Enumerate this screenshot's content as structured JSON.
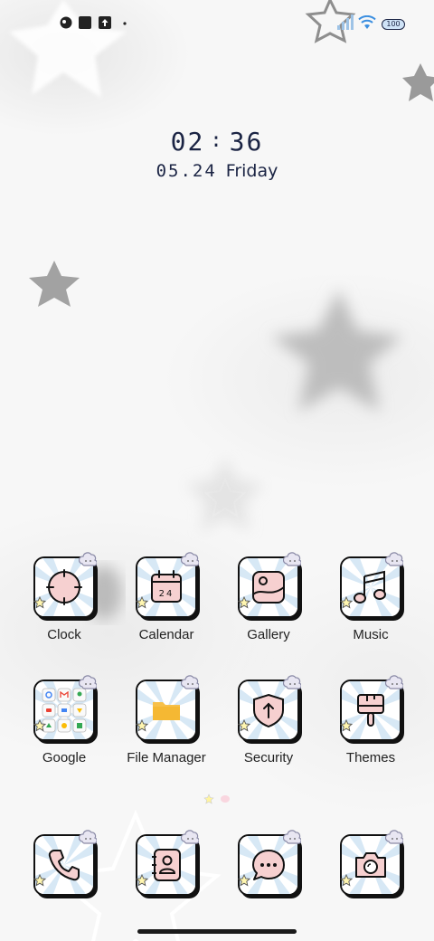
{
  "status_bar": {
    "left_icons": [
      "notification-face-icon",
      "square-app-icon",
      "upload-icon",
      "dot-icon"
    ],
    "right_icons": [
      "signal-icon",
      "wifi-icon",
      "battery-icon"
    ],
    "battery_level": "100"
  },
  "clock": {
    "hours": "02",
    "minutes": "36",
    "colon": ":",
    "date": "05.24",
    "weekday": "Friday"
  },
  "apps": {
    "row1": [
      {
        "label": "Clock",
        "icon": "clock-icon"
      },
      {
        "label": "Calendar",
        "icon": "calendar-icon",
        "calendar_text": "24"
      },
      {
        "label": "Gallery",
        "icon": "gallery-icon"
      },
      {
        "label": "Music",
        "icon": "music-icon"
      }
    ],
    "row2": [
      {
        "label": "Google",
        "icon": "google-folder-icon"
      },
      {
        "label": "File Manager",
        "icon": "folder-icon"
      },
      {
        "label": "Security",
        "icon": "shield-icon"
      },
      {
        "label": "Themes",
        "icon": "brush-icon"
      }
    ]
  },
  "dock": [
    {
      "icon": "phone-icon"
    },
    {
      "icon": "contacts-icon"
    },
    {
      "icon": "messages-icon"
    },
    {
      "icon": "camera-icon"
    }
  ],
  "colors": {
    "accent_pink": "#f6d0d0",
    "ray_blue": "#d7e8f5",
    "folder_yellow": "#f7c04a",
    "text_dark": "#1b2444"
  }
}
